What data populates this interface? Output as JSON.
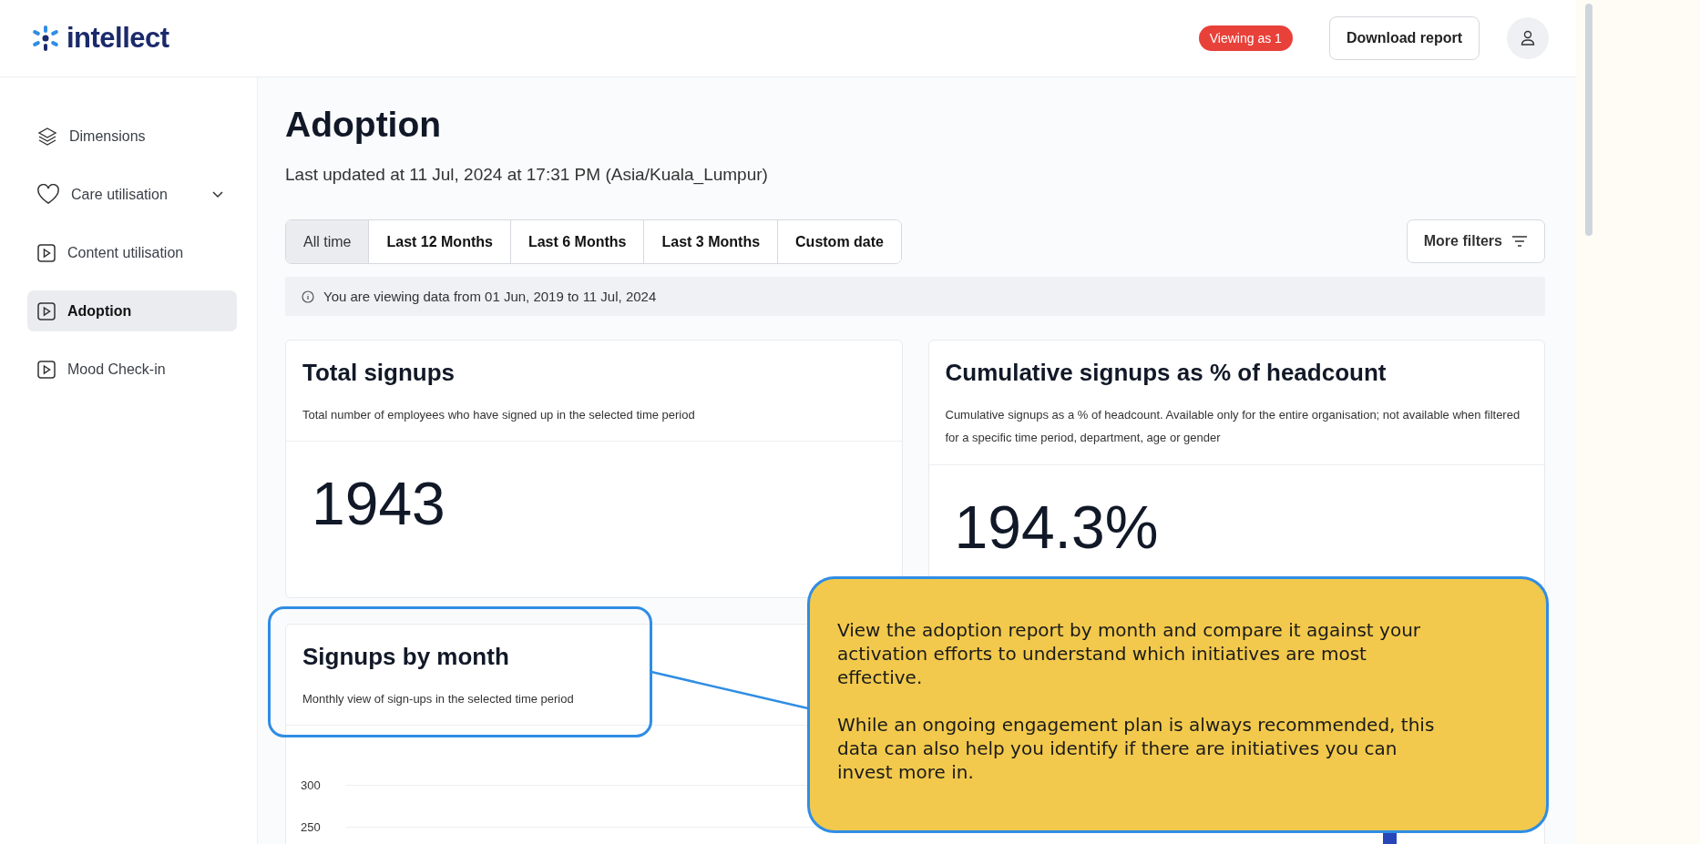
{
  "brand": {
    "name": "intellect"
  },
  "header": {
    "badge": "Viewing as 1",
    "download_button": "Download report"
  },
  "sidebar": {
    "items": [
      {
        "label": "Dimensions",
        "kind": "layers",
        "selected": false,
        "expandable": false
      },
      {
        "label": "Care utilisation",
        "kind": "heart",
        "selected": false,
        "expandable": true
      },
      {
        "label": "Content utilisation",
        "kind": "play",
        "selected": false,
        "expandable": false
      },
      {
        "label": "Adoption",
        "kind": "play",
        "selected": true,
        "expandable": false
      },
      {
        "label": "Mood Check-in",
        "kind": "play",
        "selected": false,
        "expandable": false
      }
    ]
  },
  "page": {
    "title": "Adoption",
    "subtitle": "Last updated at 11 Jul, 2024 at 17:31 PM (Asia/Kuala_Lumpur)"
  },
  "tabs": [
    {
      "label": "All time",
      "selected": true
    },
    {
      "label": "Last 12 Months",
      "selected": false
    },
    {
      "label": "Last 6 Months",
      "selected": false
    },
    {
      "label": "Last 3 Months",
      "selected": false
    },
    {
      "label": "Custom date",
      "selected": false
    }
  ],
  "more_filters": "More filters",
  "info": "You are viewing data from 01 Jun, 2019 to 11 Jul, 2024",
  "cards": [
    {
      "title": "Total signups",
      "description": "Total number of employees who have signed up in the selected time period",
      "value": "1943"
    },
    {
      "title": "Cumulative signups as % of headcount",
      "description": "Cumulative signups as a % of headcount. Available only for the entire organisation; not available when filtered for a specific time period, department, age or gender",
      "value": "194.3%"
    }
  ],
  "monthly": {
    "title": "Signups by month",
    "description": "Monthly view of sign-ups in the selected time period",
    "y_labels": [
      "300",
      "250"
    ]
  },
  "tooltip": {
    "paragraphs": [
      "View the adoption report by month and compare it against your activation efforts to understand which initiatives are most effective.",
      "While an ongoing engagement plan is always recommended, this data can also help you identify if there are initiatives you can invest more in."
    ]
  }
}
